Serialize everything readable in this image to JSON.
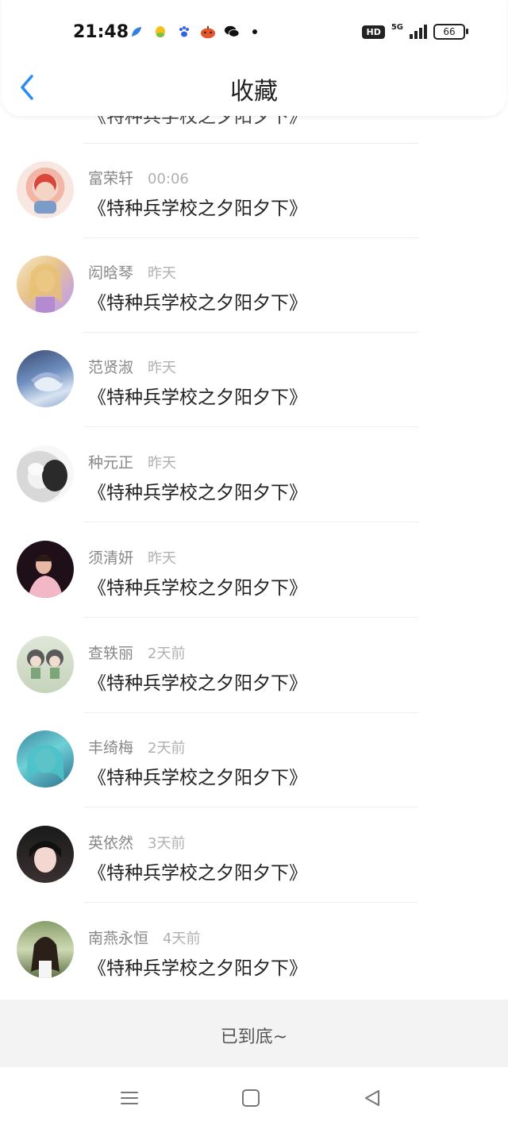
{
  "status_bar": {
    "time": "21:48",
    "network": "5G",
    "hd": "HD",
    "battery": "66",
    "icons": [
      "feather-icon",
      "qq-icon",
      "baidu-paw-icon",
      "pumpkin-icon",
      "wechat-icon"
    ]
  },
  "header": {
    "title": "收藏",
    "back_icon": "chevron-left-icon",
    "accent_color": "#2a8cf0"
  },
  "partial_top_item": "《特种兵学校之夕阳夕下》",
  "items": [
    {
      "name": "富荣轩",
      "time": "00:06",
      "message": "《特种兵学校之夕阳夕下》"
    },
    {
      "name": "闳晗琴",
      "time": "昨天",
      "message": "《特种兵学校之夕阳夕下》"
    },
    {
      "name": "范贤淑",
      "time": "昨天",
      "message": "《特种兵学校之夕阳夕下》"
    },
    {
      "name": "种元正",
      "time": "昨天",
      "message": "《特种兵学校之夕阳夕下》"
    },
    {
      "name": "须清妍",
      "time": "昨天",
      "message": "《特种兵学校之夕阳夕下》"
    },
    {
      "name": "查轶丽",
      "time": "2天前",
      "message": "《特种兵学校之夕阳夕下》"
    },
    {
      "name": "丰绮梅",
      "time": "2天前",
      "message": "《特种兵学校之夕阳夕下》"
    },
    {
      "name": "英依然",
      "time": "3天前",
      "message": "《特种兵学校之夕阳夕下》"
    },
    {
      "name": "南燕永恒",
      "time": "4天前",
      "message": "《特种兵学校之夕阳夕下》"
    }
  ],
  "footer": {
    "end_text": "已到底~"
  },
  "navbar": {
    "icons": [
      "menu-icon",
      "home-square-icon",
      "back-triangle-icon"
    ]
  }
}
